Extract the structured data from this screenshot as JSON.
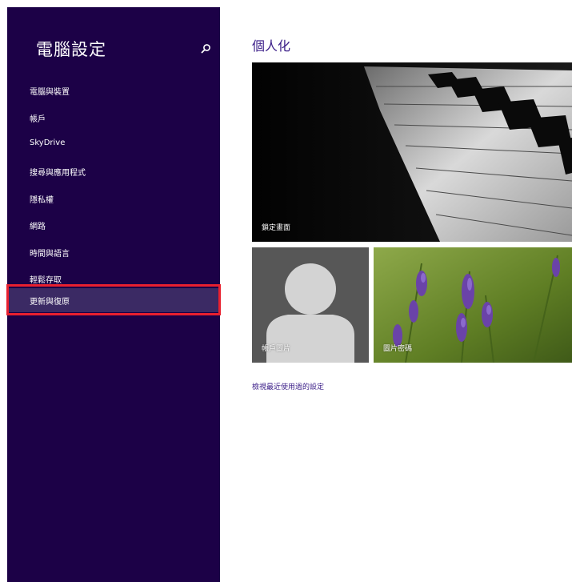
{
  "sidebar": {
    "title": "電腦設定",
    "items": [
      {
        "label": "電腦與裝置"
      },
      {
        "label": "帳戶"
      },
      {
        "label": "SkyDrive"
      },
      {
        "label": "搜尋與應用程式"
      },
      {
        "label": "隱私權"
      },
      {
        "label": "網路"
      },
      {
        "label": "時間與語言"
      },
      {
        "label": "輕鬆存取"
      },
      {
        "label": "更新與復原",
        "selected": true
      }
    ]
  },
  "main": {
    "title": "個人化",
    "tiles": {
      "lock_screen": "鎖定畫面",
      "account_picture": "帳戶圖片",
      "picture_password": "圖片密碼"
    },
    "recent_link": "檢視最近使用過的設定"
  },
  "colors": {
    "sidebar_bg": "#1c0147",
    "selected_bg": "#3b2a64",
    "accent_text": "#3b1e88",
    "highlight_border": "#e8202f"
  },
  "icons": {
    "search": "search-icon"
  }
}
